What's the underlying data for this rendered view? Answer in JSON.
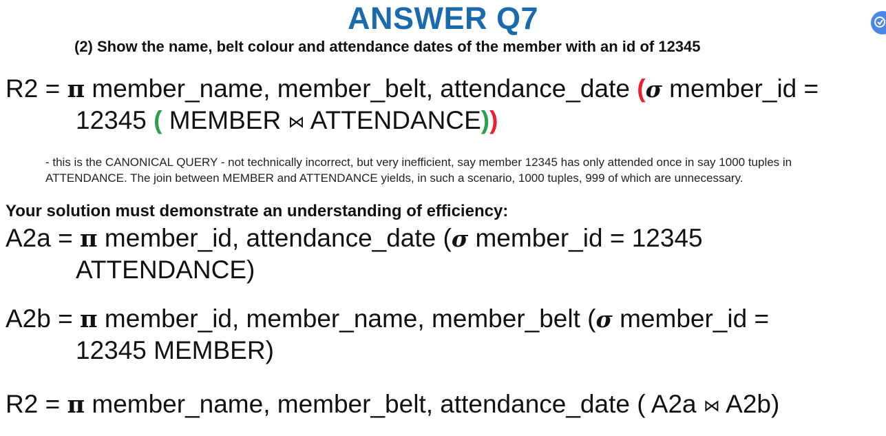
{
  "title": "ANSWER Q7",
  "subtitle": "(2)  Show the name, belt colour and attendance dates of the member with an id of 12345",
  "symbols": {
    "pi": "π",
    "sigma": "σ",
    "join": "⋈"
  },
  "canonical": {
    "line1_prefix": "R2 = ",
    "line1_attrs": " member_name, member_belt, attendance_date ",
    "paren_open_red": "(",
    "line1_cond": " member_id =",
    "line2_value": "12345 ",
    "paren_open_green": "(",
    "line2_left": " MEMBER ",
    "line2_right": " ATTENDANCE",
    "paren_close_green": ")",
    "paren_close_red": ")"
  },
  "note": {
    "line1": "- this is the CANONICAL QUERY - not technically incorrect, but very inefficient, say member 12345 has only attended once in say 1000 tuples in",
    "line2": "ATTENDANCE. The join between MEMBER and ATTENDANCE yields, in such a scenario, 1000 tuples, 999 of which are unnecessary."
  },
  "lead_text": "Your solution must demonstrate an understanding of efficiency:",
  "a2a": {
    "prefix": "A2a = ",
    "attrs": " member_id, attendance_date (",
    "cond": " member_id = 12345",
    "line2": "ATTENDANCE)"
  },
  "a2b": {
    "prefix": "A2b = ",
    "attrs": " member_id, member_name, member_belt (",
    "cond": " member_id =",
    "line2": "12345 MEMBER)"
  },
  "final": {
    "prefix": "R2 = ",
    "attrs": " member_name, member_belt, attendance_date ( A2a ",
    "suffix": " A2b)"
  },
  "colors": {
    "title": "#1a6aad",
    "open_paren_outer": "#e8222b",
    "open_paren_inner": "#2aa14a",
    "corner_icon": "#4a86e8"
  },
  "icons": {
    "corner": "corner-badge-icon"
  }
}
